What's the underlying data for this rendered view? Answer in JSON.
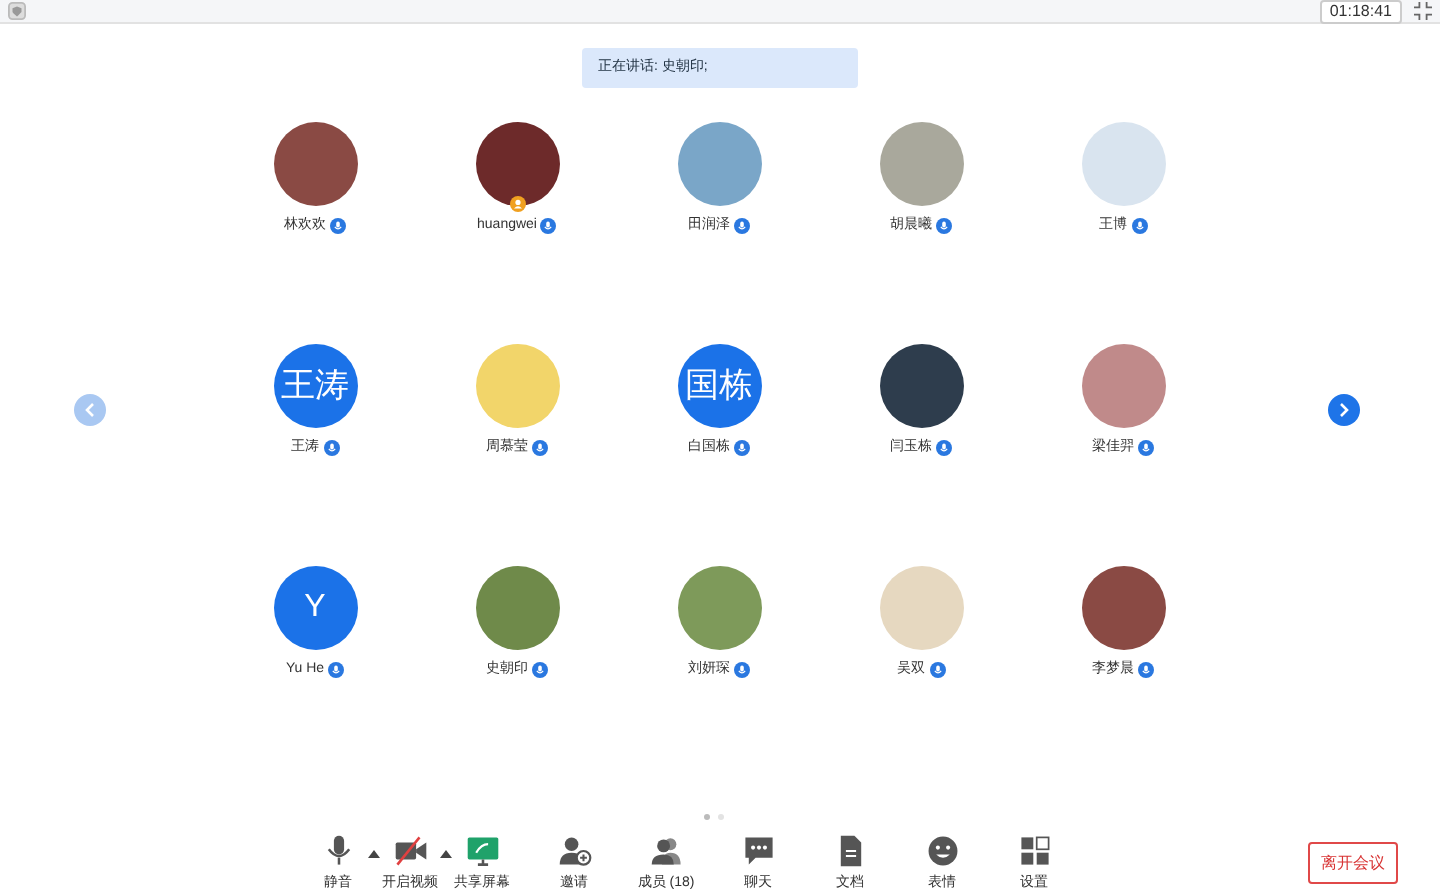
{
  "top_bar": {
    "timer": "01:18:41"
  },
  "speaker_banner": "正在讲话: 史朝印;",
  "participants": [
    {
      "name": "林欢欢",
      "kind": "photo",
      "host": false
    },
    {
      "name": "huangwei",
      "kind": "photo",
      "host": true
    },
    {
      "name": "田润泽",
      "kind": "photo",
      "host": false
    },
    {
      "name": "胡晨曦",
      "kind": "photo",
      "host": false
    },
    {
      "name": "王博",
      "kind": "photo",
      "host": false
    },
    {
      "name": "王涛",
      "kind": "initials",
      "initials": "王涛",
      "host": false
    },
    {
      "name": "周慕莹",
      "kind": "photo",
      "host": false
    },
    {
      "name": "白国栋",
      "kind": "initials",
      "initials": "国栋",
      "host": false
    },
    {
      "name": "闫玉栋",
      "kind": "photo",
      "host": false
    },
    {
      "name": "梁佳羿",
      "kind": "photo",
      "host": false
    },
    {
      "name": "Yu He",
      "kind": "initials",
      "initials": "Y",
      "host": false
    },
    {
      "name": "史朝印",
      "kind": "photo",
      "host": false
    },
    {
      "name": "刘妍琛",
      "kind": "photo",
      "host": false
    },
    {
      "name": "吴双",
      "kind": "photo",
      "host": false
    },
    {
      "name": "李梦晨",
      "kind": "photo",
      "host": false
    }
  ],
  "pager": [
    {
      "selected": true
    },
    {
      "selected": false
    }
  ],
  "toolbar": [
    {
      "label": "静音",
      "kind": "mic",
      "caret": true
    },
    {
      "label": "开启视频",
      "kind": "camera-off",
      "caret": true
    },
    {
      "label": "共享屏幕",
      "kind": "screen",
      "caret": false
    },
    {
      "label": "邀请",
      "kind": "invite",
      "caret": false
    },
    {
      "label": "成员 (18)",
      "kind": "members",
      "caret": false
    },
    {
      "label": "聊天",
      "kind": "chat",
      "caret": false
    },
    {
      "label": "文档",
      "kind": "doc",
      "caret": false
    },
    {
      "label": "表情",
      "kind": "smile",
      "caret": false
    },
    {
      "label": "设置",
      "kind": "grid",
      "caret": false
    }
  ],
  "leave_button": "离开会议"
}
